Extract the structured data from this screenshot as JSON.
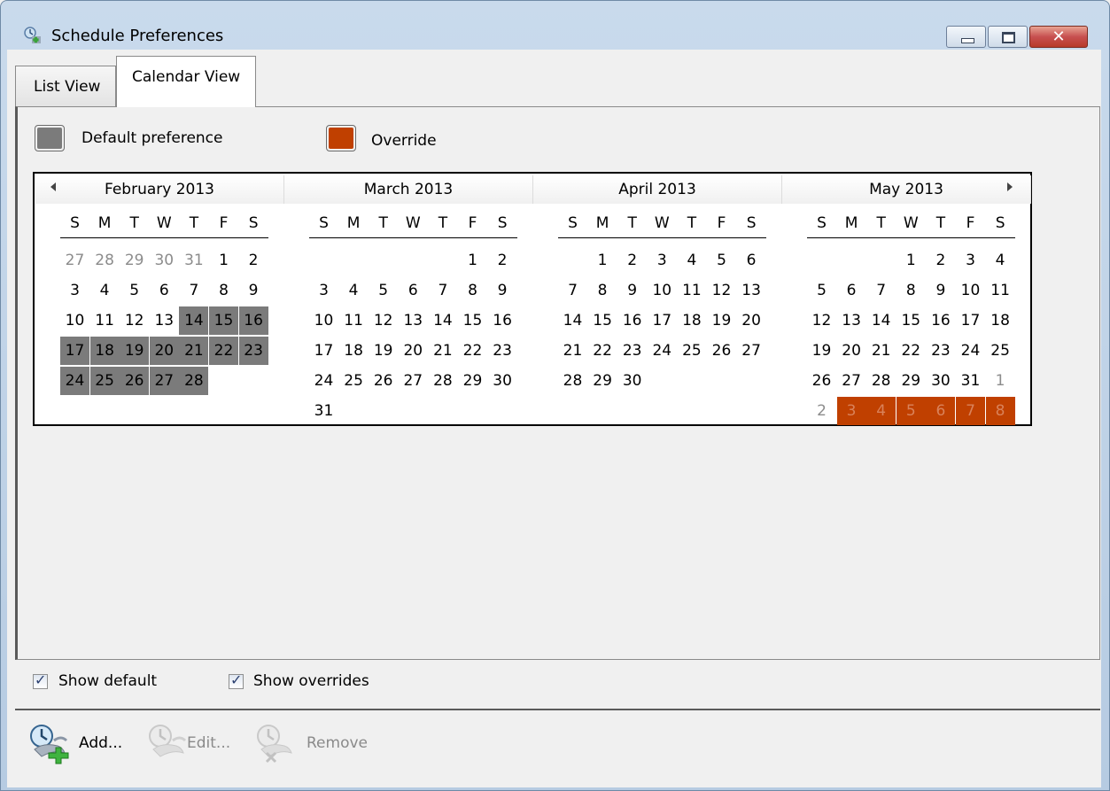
{
  "window": {
    "title": "Schedule Preferences",
    "close_glyph": "✕"
  },
  "tabs": [
    {
      "label": "List View"
    },
    {
      "label": "Calendar View"
    }
  ],
  "legend": {
    "default_label": "Default preference",
    "default_color": "#7b7b7b",
    "override_label": "Override",
    "override_color": "#c04000"
  },
  "calendar": {
    "day_headers": [
      "S",
      "M",
      "T",
      "W",
      "T",
      "F",
      "S"
    ],
    "months": [
      {
        "title": "February 2013",
        "days": [
          [
            "27",
            "28",
            "29",
            "30",
            "31",
            "1",
            "2"
          ],
          [
            "3",
            "4",
            "5",
            "6",
            "7",
            "8",
            "9"
          ],
          [
            "10",
            "11",
            "12",
            "13",
            "14",
            "15",
            "16"
          ],
          [
            "17",
            "18",
            "19",
            "20",
            "21",
            "22",
            "23"
          ],
          [
            "24",
            "25",
            "26",
            "27",
            "28",
            "",
            ""
          ],
          [
            "",
            "",
            "",
            "",
            "",
            "",
            ""
          ]
        ],
        "other": [
          [
            1,
            1,
            1,
            1,
            1,
            0,
            0
          ],
          [
            0,
            0,
            0,
            0,
            0,
            0,
            0
          ],
          [
            0,
            0,
            0,
            0,
            0,
            0,
            0
          ],
          [
            0,
            0,
            0,
            0,
            0,
            0,
            0
          ],
          [
            0,
            0,
            0,
            0,
            0,
            0,
            0
          ],
          [
            0,
            0,
            0,
            0,
            0,
            0,
            0
          ]
        ],
        "marks": [
          [
            "",
            "",
            "",
            "",
            "",
            "",
            ""
          ],
          [
            "",
            "",
            "",
            "",
            "",
            "",
            ""
          ],
          [
            "",
            "",
            "",
            "",
            "d",
            "d",
            "d"
          ],
          [
            "d",
            "d",
            "d",
            "d",
            "d",
            "d",
            "d"
          ],
          [
            "d",
            "d",
            "d",
            "d",
            "d",
            "",
            ""
          ],
          [
            "",
            "",
            "",
            "",
            "",
            "",
            ""
          ]
        ]
      },
      {
        "title": "March 2013",
        "days": [
          [
            "",
            "",
            "",
            "",
            "",
            "1",
            "2"
          ],
          [
            "3",
            "4",
            "5",
            "6",
            "7",
            "8",
            "9"
          ],
          [
            "10",
            "11",
            "12",
            "13",
            "14",
            "15",
            "16"
          ],
          [
            "17",
            "18",
            "19",
            "20",
            "21",
            "22",
            "23"
          ],
          [
            "24",
            "25",
            "26",
            "27",
            "28",
            "29",
            "30"
          ],
          [
            "31",
            "",
            "",
            "",
            "",
            "",
            ""
          ]
        ],
        "other": [
          [
            0,
            0,
            0,
            0,
            0,
            0,
            0
          ],
          [
            0,
            0,
            0,
            0,
            0,
            0,
            0
          ],
          [
            0,
            0,
            0,
            0,
            0,
            0,
            0
          ],
          [
            0,
            0,
            0,
            0,
            0,
            0,
            0
          ],
          [
            0,
            0,
            0,
            0,
            0,
            0,
            0
          ],
          [
            0,
            0,
            0,
            0,
            0,
            0,
            0
          ]
        ],
        "marks": [
          [
            "",
            "",
            "",
            "",
            "",
            "",
            ""
          ],
          [
            "",
            "",
            "",
            "",
            "",
            "",
            ""
          ],
          [
            "",
            "",
            "",
            "",
            "",
            "",
            ""
          ],
          [
            "",
            "",
            "",
            "",
            "",
            "",
            ""
          ],
          [
            "",
            "",
            "",
            "",
            "",
            "",
            ""
          ],
          [
            "",
            "",
            "",
            "",
            "",
            "",
            ""
          ]
        ]
      },
      {
        "title": "April 2013",
        "days": [
          [
            "",
            "1",
            "2",
            "3",
            "4",
            "5",
            "6"
          ],
          [
            "7",
            "8",
            "9",
            "10",
            "11",
            "12",
            "13"
          ],
          [
            "14",
            "15",
            "16",
            "17",
            "18",
            "19",
            "20"
          ],
          [
            "21",
            "22",
            "23",
            "24",
            "25",
            "26",
            "27"
          ],
          [
            "28",
            "29",
            "30",
            "",
            "",
            "",
            ""
          ],
          [
            "",
            "",
            "",
            "",
            "",
            "",
            ""
          ]
        ],
        "other": [
          [
            0,
            0,
            0,
            0,
            0,
            0,
            0
          ],
          [
            0,
            0,
            0,
            0,
            0,
            0,
            0
          ],
          [
            0,
            0,
            0,
            0,
            0,
            0,
            0
          ],
          [
            0,
            0,
            0,
            0,
            0,
            0,
            0
          ],
          [
            0,
            0,
            0,
            0,
            0,
            0,
            0
          ],
          [
            0,
            0,
            0,
            0,
            0,
            0,
            0
          ]
        ],
        "marks": [
          [
            "",
            "",
            "",
            "",
            "",
            "",
            ""
          ],
          [
            "",
            "",
            "",
            "",
            "",
            "",
            ""
          ],
          [
            "",
            "",
            "",
            "",
            "",
            "",
            ""
          ],
          [
            "",
            "",
            "",
            "",
            "",
            "",
            ""
          ],
          [
            "",
            "",
            "",
            "",
            "",
            "",
            ""
          ],
          [
            "",
            "",
            "",
            "",
            "",
            "",
            ""
          ]
        ]
      },
      {
        "title": "May 2013",
        "days": [
          [
            "",
            "",
            "",
            "1",
            "2",
            "3",
            "4"
          ],
          [
            "5",
            "6",
            "7",
            "8",
            "9",
            "10",
            "11"
          ],
          [
            "12",
            "13",
            "14",
            "15",
            "16",
            "17",
            "18"
          ],
          [
            "19",
            "20",
            "21",
            "22",
            "23",
            "24",
            "25"
          ],
          [
            "26",
            "27",
            "28",
            "29",
            "30",
            "31",
            "1"
          ],
          [
            "2",
            "3",
            "4",
            "5",
            "6",
            "7",
            "8"
          ]
        ],
        "other": [
          [
            0,
            0,
            0,
            0,
            0,
            0,
            0
          ],
          [
            0,
            0,
            0,
            0,
            0,
            0,
            0
          ],
          [
            0,
            0,
            0,
            0,
            0,
            0,
            0
          ],
          [
            0,
            0,
            0,
            0,
            0,
            0,
            0
          ],
          [
            0,
            0,
            0,
            0,
            0,
            0,
            1
          ],
          [
            1,
            1,
            1,
            1,
            1,
            1,
            1
          ]
        ],
        "marks": [
          [
            "",
            "",
            "",
            "",
            "",
            "",
            ""
          ],
          [
            "",
            "",
            "",
            "",
            "",
            "",
            ""
          ],
          [
            "",
            "",
            "",
            "",
            "",
            "",
            ""
          ],
          [
            "",
            "",
            "",
            "",
            "",
            "",
            ""
          ],
          [
            "",
            "",
            "",
            "",
            "",
            "",
            ""
          ],
          [
            "",
            "o",
            "o",
            "o",
            "o",
            "o",
            "o"
          ]
        ]
      }
    ]
  },
  "options": {
    "show_default_label": "Show default",
    "show_default_checked": true,
    "show_overrides_label": "Show overrides",
    "show_overrides_checked": true
  },
  "toolbar": {
    "add_label": "Add...",
    "edit_label": "Edit...",
    "remove_label": "Remove",
    "add_icon": "add-schedule-icon",
    "edit_icon": "edit-schedule-icon",
    "remove_icon": "remove-schedule-icon"
  }
}
